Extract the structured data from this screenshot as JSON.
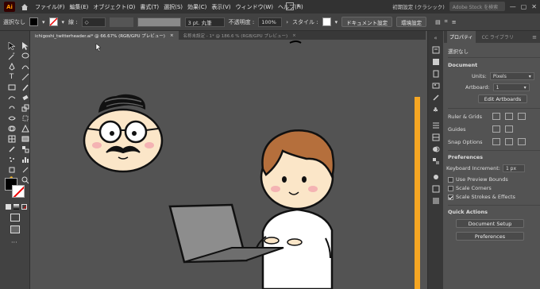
{
  "app": {
    "logo": "Ai"
  },
  "menubar": {
    "items": [
      "ファイル(F)",
      "編集(E)",
      "オブジェクト(O)",
      "書式(T)",
      "選択(S)",
      "効果(C)",
      "表示(V)",
      "ウィンドウ(W)",
      "ヘルプ(H)"
    ],
    "workspace": "初期設定 (クラシック)",
    "search_placeholder": "Adobe Stock を検索"
  },
  "controlbar": {
    "selection_label": "選択なし",
    "stroke_label": "線 :",
    "stroke_value": "◇",
    "brush_value": "3 pt. 丸筆",
    "opacity_label": "不透明度 :",
    "opacity_value": "100%",
    "style_label": "スタイル :",
    "doc_settings": "ドキュメント設定",
    "prefs": "環境設定"
  },
  "tabs": [
    {
      "label": "ichigoshi_twitterheader.ai* @ 66.67% (RGB/GPU プレビュー)",
      "close": "×"
    },
    {
      "label": "名称未設定 - 1* @ 186.6 % (RGB/GPU プレビュー)",
      "close": "×"
    }
  ],
  "panel": {
    "tabs": [
      "プロパティ",
      "CC ライブラリ"
    ],
    "selection": "選択なし",
    "document_title": "Document",
    "units_label": "Units:",
    "units_value": "Pixels",
    "artboard_label": "Artboard:",
    "artboard_value": "1",
    "edit_artboards": "Edit Artboards",
    "ruler_grids": "Ruler & Grids",
    "guides": "Guides",
    "snap_options": "Snap Options",
    "preferences_title": "Preferences",
    "keyboard_increment_label": "Keyboard Increment:",
    "keyboard_increment_value": "1 px",
    "checkboxes": [
      {
        "label": "Use Preview Bounds",
        "checked": false
      },
      {
        "label": "Scale Corners",
        "checked": false
      },
      {
        "label": "Scale Strokes & Effects",
        "checked": true
      }
    ],
    "quick_actions_title": "Quick Actions",
    "document_setup": "Document Setup",
    "preferences_button": "Preferences"
  },
  "colors": {
    "accent_bar": "#f5a623"
  }
}
